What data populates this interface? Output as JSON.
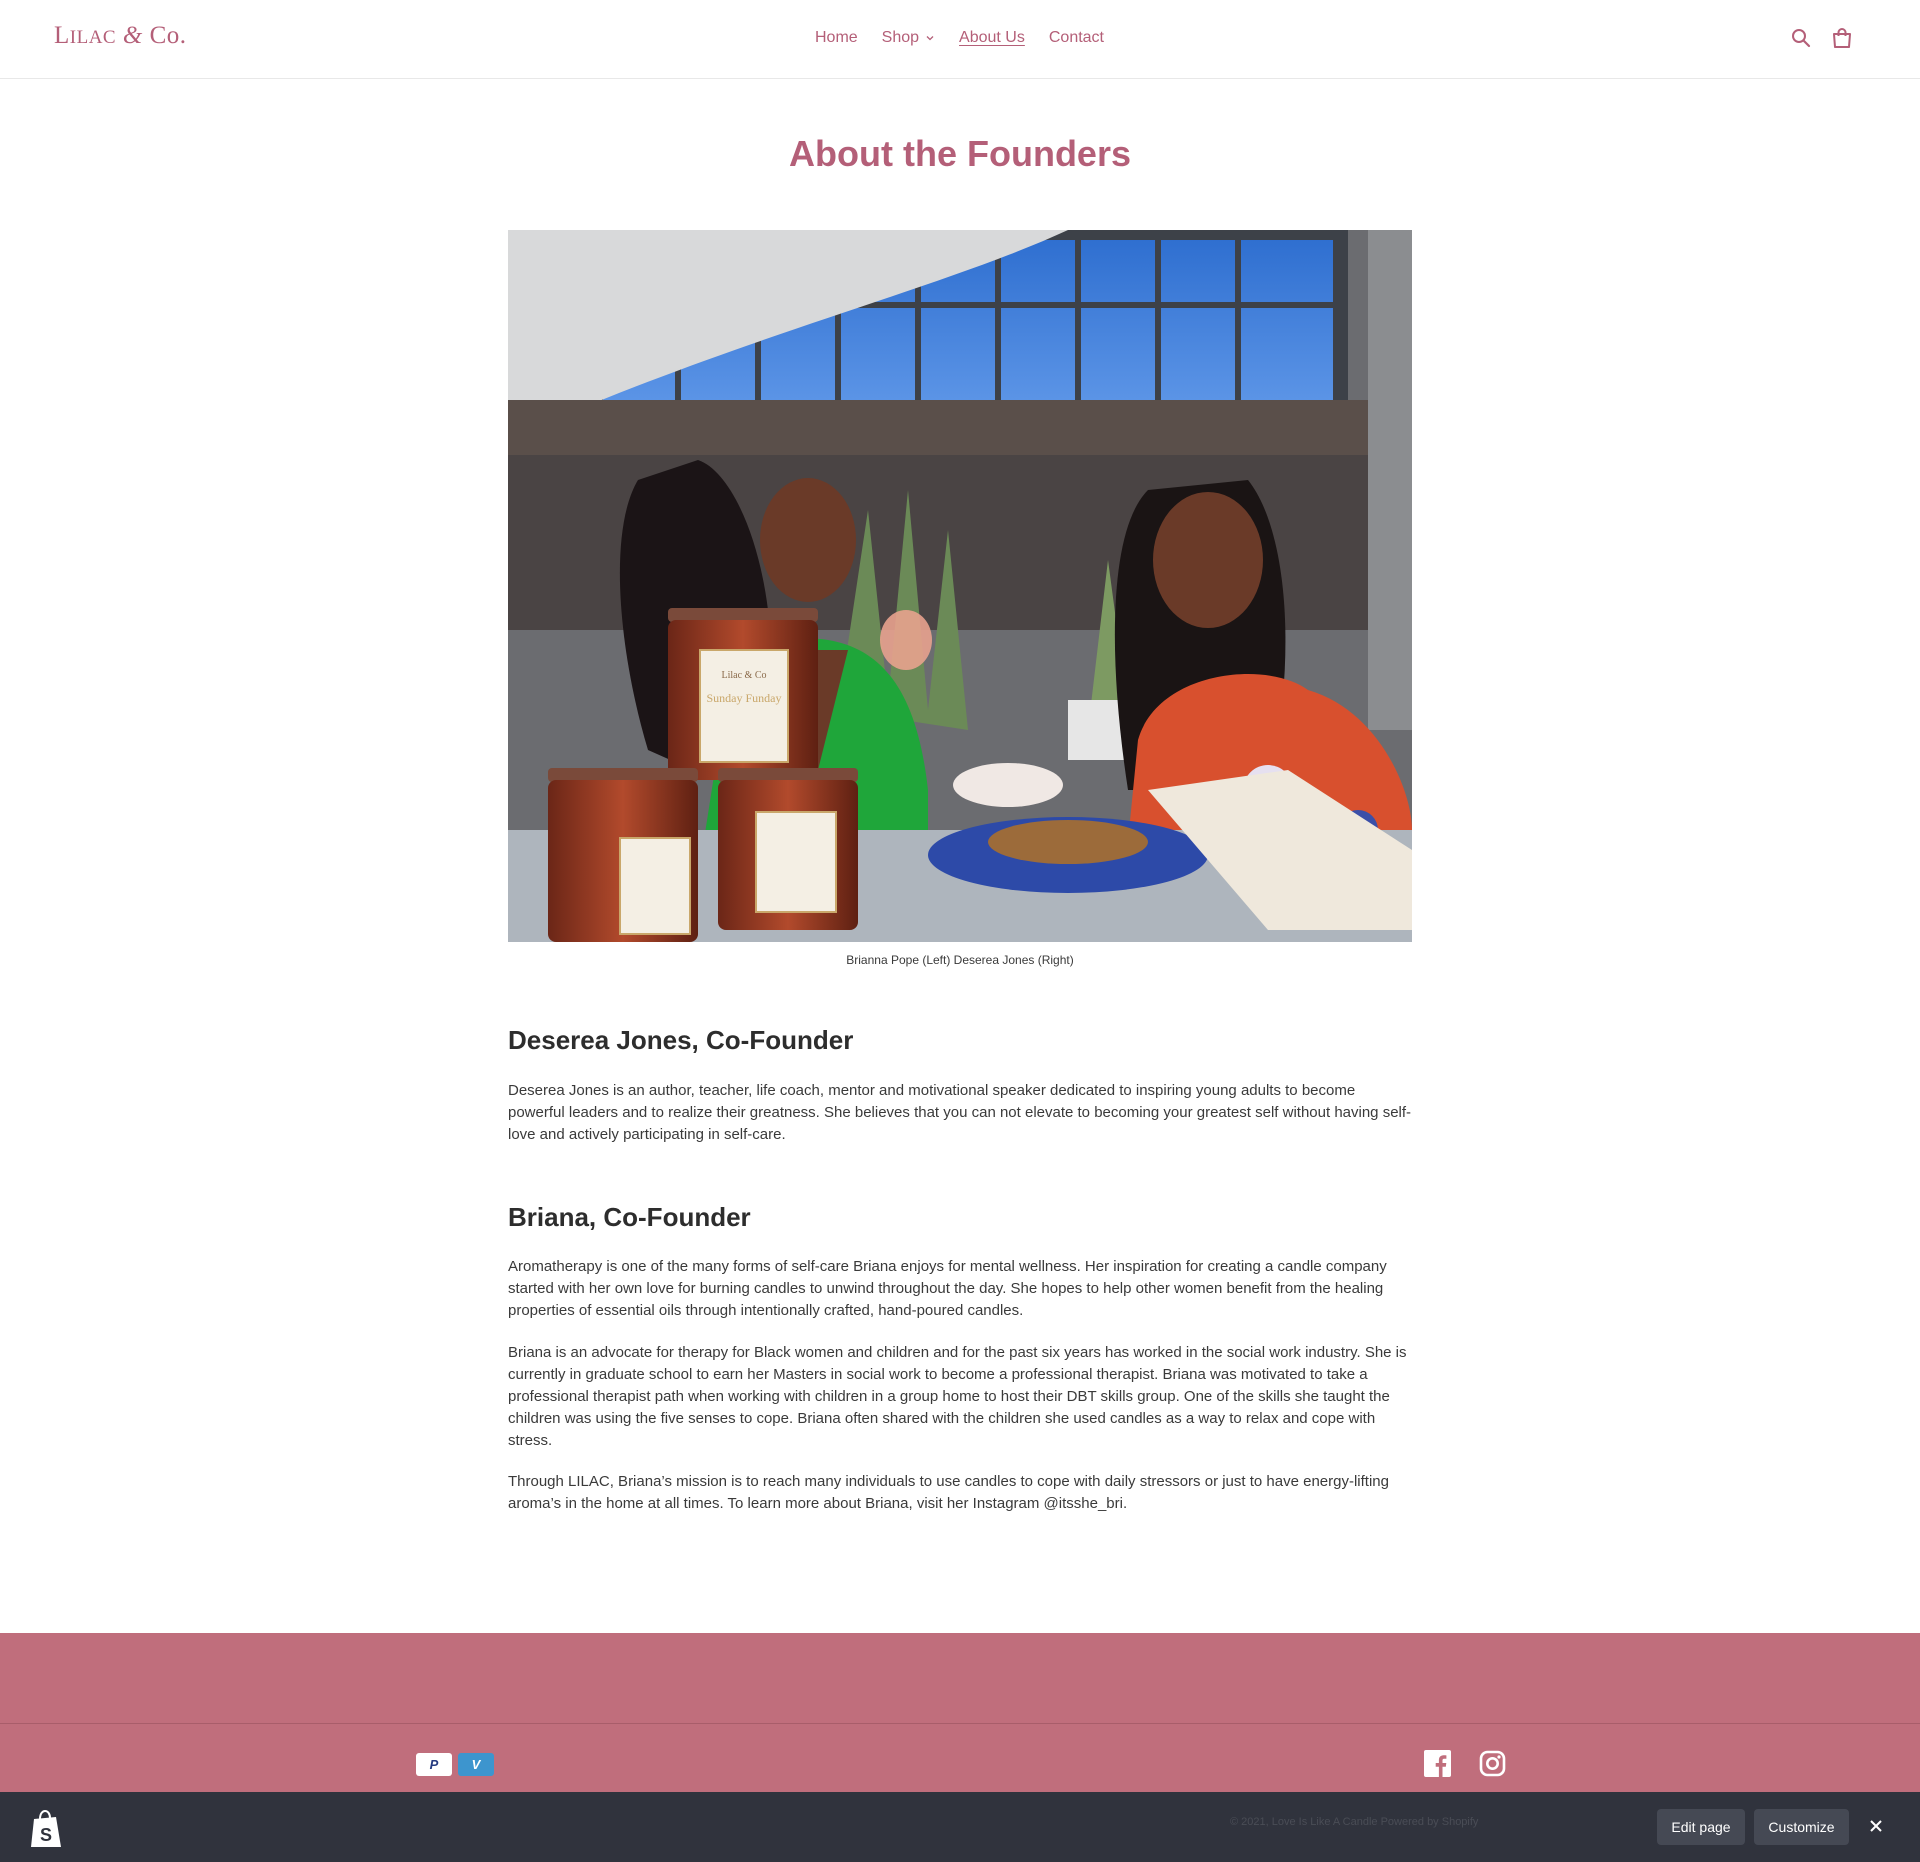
{
  "header": {
    "logo_main": "L",
    "logo_rest": "ILAC",
    "logo_amp": "&",
    "logo_end": "Co.",
    "nav": [
      {
        "label": "Home"
      },
      {
        "label": "Shop"
      },
      {
        "label": "About Us"
      },
      {
        "label": "Contact"
      }
    ]
  },
  "main": {
    "title": "About the Founders",
    "photo_caption": "Brianna Pope (Left) Deserea Jones (Right)",
    "photo_jar_label_brand": "Lilac & Co",
    "photo_jar_label_name": "Sunday Funday",
    "founders": [
      {
        "heading": "Deserea Jones, Co-Founder",
        "paragraphs": [
          "Deserea Jones is an author, teacher, life coach, mentor and motivational speaker dedicated to inspiring young adults to become powerful leaders and to realize their greatness. She believes that you can not elevate to becoming your greatest self without having self-love and actively participating in self-care."
        ]
      },
      {
        "heading": "Briana, Co-Founder",
        "paragraphs": [
          "Aromatherapy is one of the many forms of self-care Briana enjoys for mental wellness. Her inspiration for creating a candle company started with her own love for burning candles to unwind throughout the day. She hopes to help other women benefit from the healing properties of essential oils through intentionally crafted, hand-poured candles.",
          "Briana is an advocate for therapy for Black women and children and for the past six years has worked in the social work industry. She is currently in graduate school to earn her Masters in social work to become a professional therapist. Briana was motivated to take a professional therapist path when working with children in a group home to host their DBT skills group. One of the skills she taught the children was using the five senses to cope. Briana often shared with the children she used candles as a way to relax and cope with stress.",
          "Through LILAC, Briana’s mission is to reach many individuals to use candles to cope with daily stressors or just to have energy-lifting aroma’s in the home at all times. To learn more about Briana, visit her Instagram @itsshe_bri."
        ]
      }
    ]
  },
  "footer": {
    "payment_icons": [
      "paypal-icon",
      "venmo-icon"
    ],
    "paypal_glyph": "P",
    "venmo_glyph": "V",
    "social_icons": [
      "facebook-icon",
      "instagram-icon"
    ],
    "copyright": "© 2021, Love Is Like A Candle Powered by Shopify"
  },
  "admin_bar": {
    "edit_label": "Edit page",
    "customize_label": "Customize"
  },
  "colors": {
    "brand": "#b45f78",
    "footer_bg": "#c06e7c",
    "admin_bg": "#30333d"
  }
}
